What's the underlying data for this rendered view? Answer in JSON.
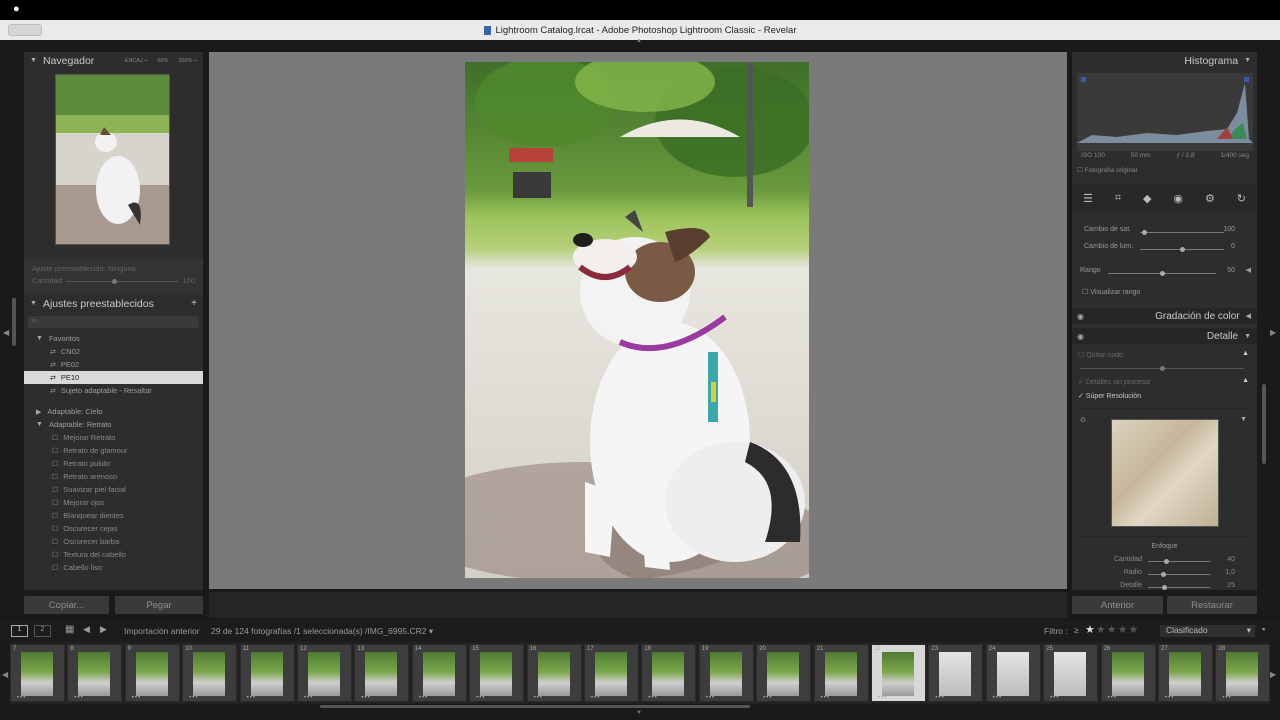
{
  "window": {
    "title": "Lightroom Catalog.lrcat - Adobe Photoshop Lightroom Classic - Revelar"
  },
  "navigator": {
    "title": "Navegador",
    "zoom_options": [
      "ENCAJ ÷",
      "50%",
      "200% ÷"
    ]
  },
  "presets": {
    "adjust_label": "Ajuste preestablecido: Ninguno",
    "amount_label": "Cantidad",
    "amount_value": "100",
    "title": "Ajustes preestablecidos",
    "add_label": "+",
    "favorites_group": "Favoritos",
    "favorites": [
      "CN02",
      "PE02",
      "PE10",
      "Sujeto adaptable - Resaltar"
    ],
    "selected_index": 2,
    "group_sky": "Adaptable: Cielo",
    "group_portrait": "Adaptable: Retrato",
    "portrait_items": [
      "Mejorar Retrato",
      "Retrato de glamour",
      "Retrato pulido",
      "Retrato arenoso",
      "Suavizar piel facial",
      "Mejorar ojos",
      "Blanquear dientes",
      "Oscurecer cejas",
      "Oscurecer barba",
      "Textura del cabello",
      "Cabello liso"
    ]
  },
  "left_buttons": {
    "copy": "Copiar...",
    "paste": "Pegar"
  },
  "histogram": {
    "title": "Histograma",
    "iso": "ISO 100",
    "focal": "50 mm",
    "aperture": "ƒ / 2,8",
    "shutter": "1/400 seg",
    "original_label": "Fotografía original"
  },
  "tools": [
    "sliders-icon",
    "crop-icon",
    "eraser-icon",
    "redeye-icon",
    "mask-icon",
    "reset-icon"
  ],
  "color_section": {
    "sat_label": "Cambio de sat.",
    "sat_value": "100",
    "lum_label": "Cambio de lum.",
    "lum_value": "0",
    "range_label": "Rango",
    "range_value": "50",
    "visualize_label": "Visualizar rango"
  },
  "sections": {
    "color_grading": "Gradación de color",
    "detail": "Detalle"
  },
  "detail": {
    "noise_label": "Quitar ruido",
    "raw_label": "Detalles sin procesar",
    "super_res_label": "Súper Resolución",
    "sharpen_title": "Enfoque",
    "sharpen_rows": [
      {
        "label": "Cantidad",
        "value": "40"
      },
      {
        "label": "Radio",
        "value": "1,0"
      },
      {
        "label": "Detalle",
        "value": "25"
      }
    ]
  },
  "right_buttons": {
    "previous": "Anterior",
    "reset": "Restaurar"
  },
  "filmbar": {
    "source": "Importación anterior",
    "count": "29 de 124 fotografías /1 seleccionada(s) /IMG_6995.CR2 ▾",
    "filter_label": "Filtro :",
    "filter_op": "≥",
    "sort": "Clasificado"
  },
  "filmstrip": {
    "numbers": [
      "7",
      "8",
      "9",
      "10",
      "11",
      "12",
      "13",
      "14",
      "15",
      "16",
      "17",
      "18",
      "19",
      "20",
      "21",
      "22",
      "23",
      "24",
      "25",
      "26",
      "27",
      "28"
    ],
    "selected_index": 15,
    "colors": {
      "green": "#4f7a34",
      "light": "#cfcfcf"
    }
  }
}
